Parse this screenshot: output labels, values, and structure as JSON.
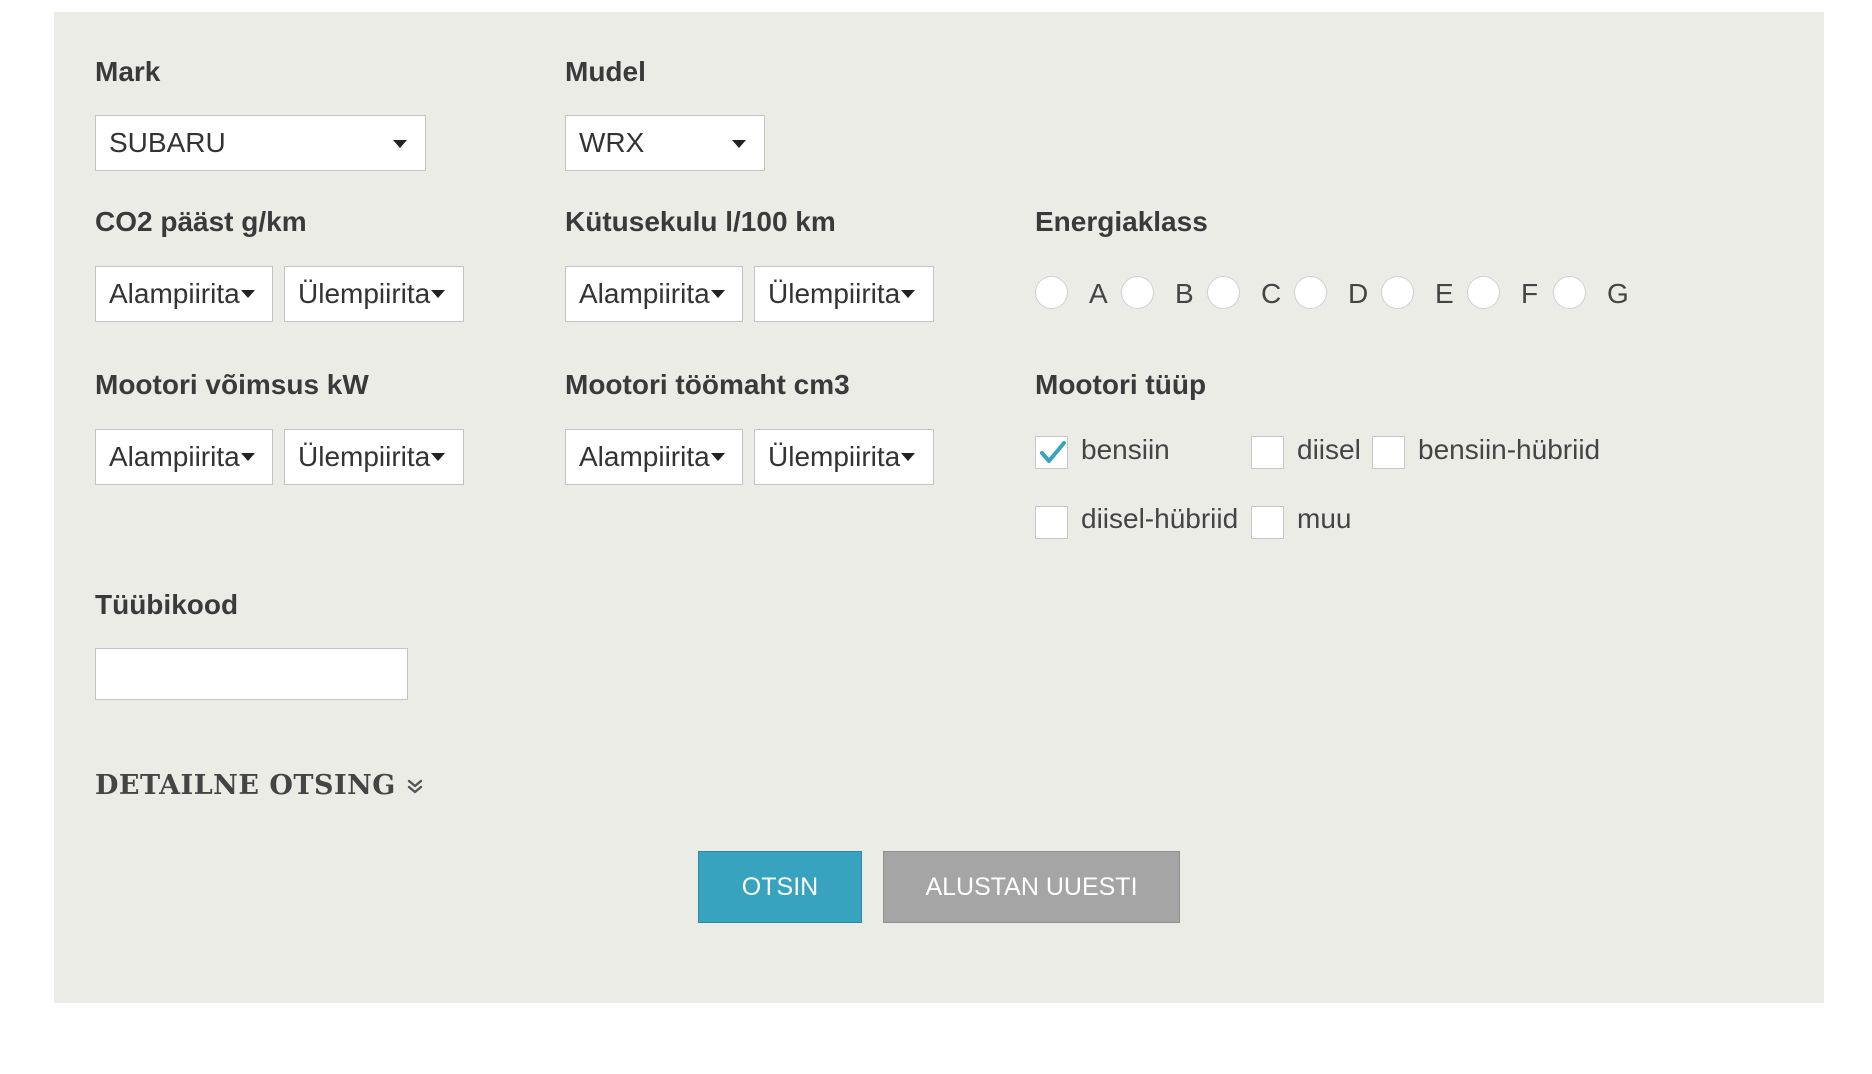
{
  "fields": {
    "mark": {
      "label": "Mark",
      "value": "SUBARU"
    },
    "mudel": {
      "label": "Mudel",
      "value": "WRX"
    },
    "co2": {
      "label": "CO2 pääst g/km",
      "min": "Alampiirita",
      "max": "Ülempiirita"
    },
    "kytusekulu": {
      "label": "Kütusekulu l/100 km",
      "min": "Alampiirita",
      "max": "Ülempiirita"
    },
    "energiaklass": {
      "label": "Energiaklass",
      "options": [
        "A",
        "B",
        "C",
        "D",
        "E",
        "F",
        "G"
      ]
    },
    "voimsus": {
      "label": "Mootori võimsus kW",
      "min": "Alampiirita",
      "max": "Ülempiirita"
    },
    "toomaht": {
      "label": "Mootori töömaht cm3",
      "min": "Alampiirita",
      "max": "Ülempiirita"
    },
    "mootori_tyyp": {
      "label": "Mootori tüüp",
      "options": [
        {
          "label": "bensiin",
          "checked": true
        },
        {
          "label": "diisel",
          "checked": false
        },
        {
          "label": "bensiin-hübriid",
          "checked": false
        },
        {
          "label": "diisel-hübriid",
          "checked": false
        },
        {
          "label": "muu",
          "checked": false
        }
      ]
    },
    "tyybikood": {
      "label": "Tüübikood",
      "value": ""
    }
  },
  "detail_search": {
    "label": "DETAILNE OTSING"
  },
  "buttons": {
    "search": "OTSIN",
    "reset": "ALUSTAN UUESTI"
  },
  "colors": {
    "panel": "#ecece7",
    "search_button": "#37a3bf",
    "reset_button": "#a5a5a5",
    "check": "#37a3bf"
  },
  "icons": {
    "detail_toggle": "double-chevron-down-icon",
    "checkmark": "checkmark-icon"
  }
}
